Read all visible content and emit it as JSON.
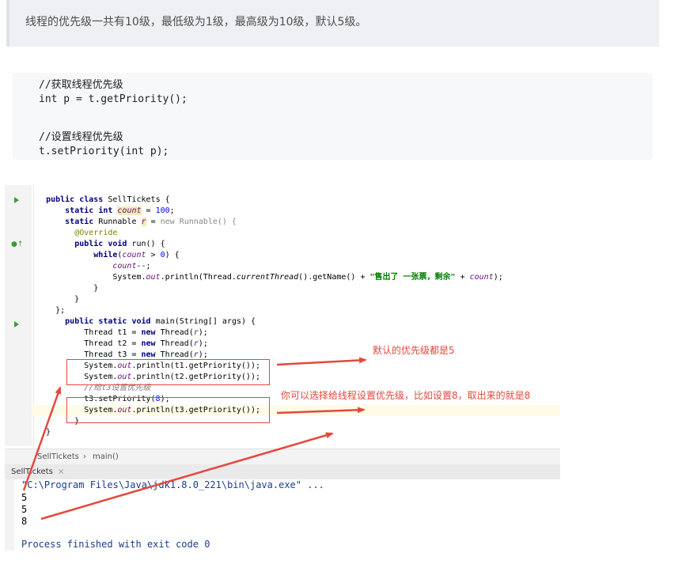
{
  "intro": {
    "text": "线程的优先级一共有10级，最低级为1级，最高级为10级，默认5级。"
  },
  "snippet": {
    "lines": [
      "//获取线程优先级",
      "int p = t.getPriority();",
      "",
      "//设置线程优先级",
      "t.setPriority(int p);"
    ]
  },
  "editor": {
    "tokens": {
      "public": "public",
      "class": "class",
      "static": "static",
      "int": "int",
      "void": "void",
      "while": "while",
      "new": "new",
      "class_name": "SellTickets",
      "count": "count",
      "r": "r",
      "runnable": "Runnable",
      "override": "@Override",
      "run": "run",
      "string_literal": "\"售出了 一张票，剩余\"",
      "args": "String[] args",
      "main": "main"
    },
    "comment_line": "//给t3设置优先级"
  },
  "annotations": {
    "default_priority": "默认的优先级都是5",
    "set_priority": "你可以选择给线程设置优先级，比如设置8，取出来的就是8"
  },
  "breadcrumb": {
    "class": "SellTickets",
    "separator": "›",
    "method": "main()"
  },
  "run_panel": {
    "tab": "SellTickets",
    "close": "×",
    "command": "\"C:\\Program Files\\Java\\jdk1.8.0_221\\bin\\java.exe\" ...",
    "outputs": [
      "5",
      "5",
      "8"
    ],
    "exit": "Process finished with exit code 0"
  },
  "colors": {
    "annotation_red": "#e5483d",
    "keyword": "#000080",
    "field": "#660e7a",
    "string": "#008000"
  }
}
